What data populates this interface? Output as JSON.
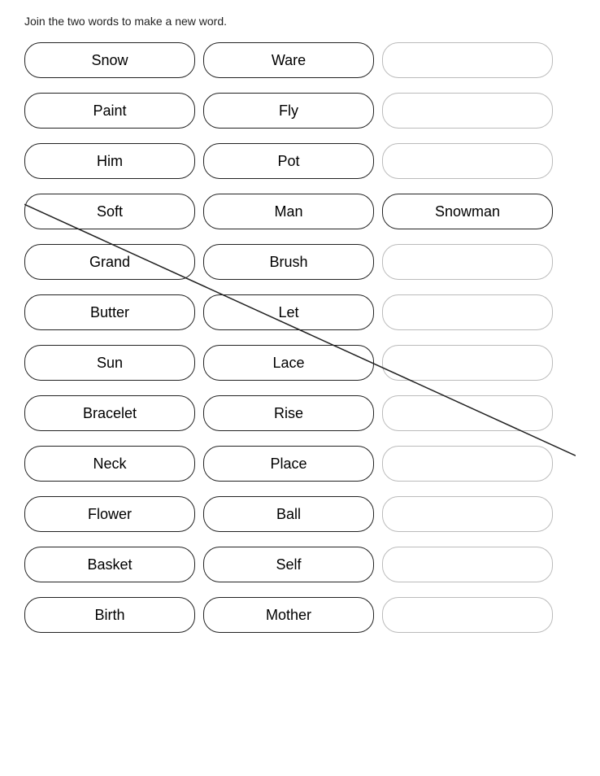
{
  "instruction": "Join the two words to make a new word.",
  "rows": [
    {
      "col1": "Snow",
      "col2": "Ware",
      "col3": ""
    },
    {
      "col1": "Paint",
      "col2": "Fly",
      "col3": ""
    },
    {
      "col1": "Him",
      "col2": "Pot",
      "col3": ""
    },
    {
      "col1": "Soft",
      "col2": "Man",
      "col3": "Snowman"
    },
    {
      "col1": "Grand",
      "col2": "Brush",
      "col3": ""
    },
    {
      "col1": "Butter",
      "col2": "Let",
      "col3": ""
    },
    {
      "col1": "Sun",
      "col2": "Lace",
      "col3": ""
    },
    {
      "col1": "Bracelet",
      "col2": "Rise",
      "col3": ""
    },
    {
      "col1": "Neck",
      "col2": "Place",
      "col3": ""
    },
    {
      "col1": "Flower",
      "col2": "Ball",
      "col3": ""
    },
    {
      "col1": "Basket",
      "col2": "Self",
      "col3": ""
    },
    {
      "col1": "Birth",
      "col2": "Mother",
      "col3": ""
    }
  ]
}
